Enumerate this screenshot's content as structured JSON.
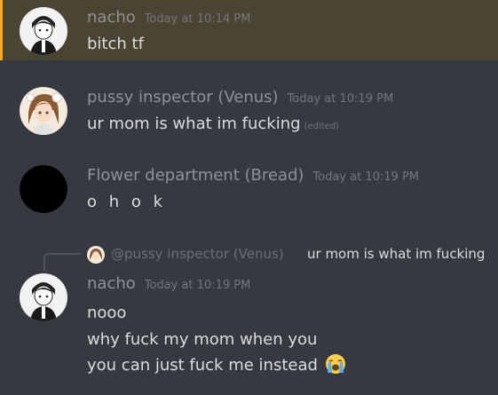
{
  "messages": [
    {
      "author": "nacho",
      "timestamp": "Today at 10:14 PM",
      "lines": [
        "bitch tf"
      ],
      "avatar_icon": "anime-character-black-white-avatar",
      "highlighted": true
    },
    {
      "author": "pussy inspector (Venus)",
      "timestamp": "Today at 10:19 PM",
      "lines": [
        "ur mom is what im fucking"
      ],
      "edited_label": "(edited)",
      "avatar_icon": "anime-character-orange-avatar"
    },
    {
      "author": "Flower department (Bread)",
      "timestamp": "Today at 10:19 PM",
      "lines": [
        "o h o k"
      ],
      "avatar_icon": "redacted-black-avatar"
    },
    {
      "author": "nacho",
      "timestamp": "Today at 10:19 PM",
      "reply": {
        "mention": "@pussy inspector (Venus)",
        "text": "ur mom is what im fucking"
      },
      "lines": [
        "nooo",
        "why fuck my mom when you",
        "you can just fuck me instead"
      ],
      "trailing_emoji": "loudly-crying-face-emoji",
      "avatar_icon": "anime-character-black-white-avatar"
    }
  ],
  "colors": {
    "background": "#36393f",
    "highlight_background": "#4a4433",
    "highlight_bar": "#faa61a",
    "username": "#8e9297",
    "timestamp": "#72767d",
    "message_text": "#dcddde"
  }
}
